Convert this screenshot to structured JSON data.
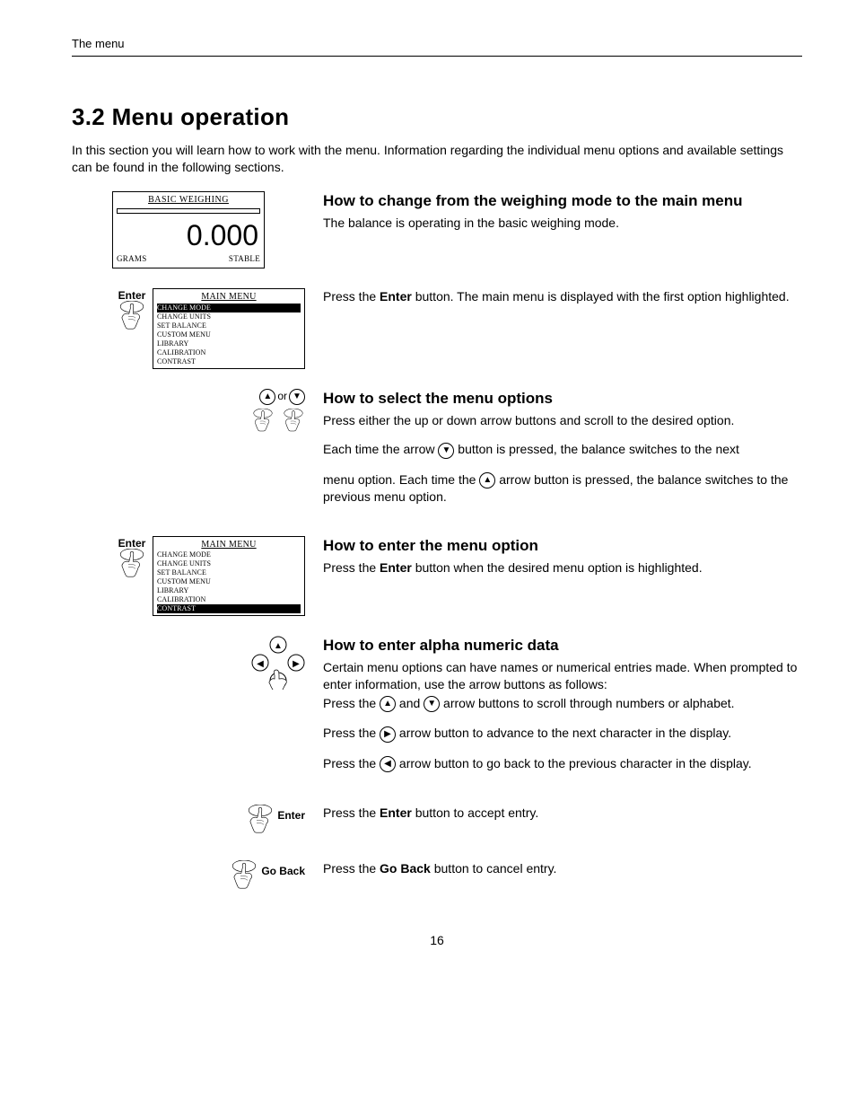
{
  "header": {
    "section": "The menu"
  },
  "title": "3.2  Menu operation",
  "intro": "In this section you will learn how to work with the menu.  Information regarding the individual menu options and available settings can be found in the following sections.",
  "lcd1": {
    "title": "BASIC WEIGHING",
    "value": "0.000",
    "unit": "GRAMS",
    "status": "STABLE"
  },
  "menu": {
    "title": "MAIN MENU",
    "items": [
      "CHANGE MODE",
      "CHANGE UNITS",
      "SET BALANCE",
      "CUSTOM MENU",
      "LIBRARY",
      "CALIBRATION",
      "CONTRAST"
    ]
  },
  "buttons": {
    "enter": "Enter",
    "goback": "Go Back",
    "or": "or"
  },
  "sec1": {
    "h": "How to change from the weighing mode to the main menu",
    "p1": "The balance is operating in the basic weighing mode.",
    "p2a": "Press the ",
    "p2b": "Enter",
    "p2c": " button.  The main menu is displayed with the first option highlighted."
  },
  "sec2": {
    "h": "How to select the menu options",
    "p1": "Press either the up or down arrow buttons and scroll to the desired option.",
    "p2a": "Each time the arrow ",
    "p2b": " button is pressed, the balance switches to the next",
    "p3a": "menu option.  Each time the ",
    "p3b": " arrow button is pressed, the balance switches to the previous menu option."
  },
  "sec3": {
    "h": "How to enter the menu option",
    "p1a": "Press the ",
    "p1b": "Enter",
    "p1c": " button when the desired menu option is highlighted."
  },
  "sec4": {
    "h": "How to enter alpha numeric data",
    "p1": "Certain menu options can have names or numerical entries made.  When prompted to enter information, use the arrow buttons as follows:",
    "p2a": "Press the ",
    "p2b": " and ",
    "p2c": " arrow buttons to scroll through numbers or alphabet.",
    "p3a": "Press the ",
    "p3b": " arrow button to advance to the next character in the display.",
    "p4a": "Press the ",
    "p4b": "  arrow button to go back to the previous character in the display.",
    "p5a": "Press the ",
    "p5b": "Enter",
    "p5c": " button to accept entry.",
    "p6a": "Press the ",
    "p6b": "Go Back",
    "p6c": " button to cancel entry."
  },
  "page": "16"
}
